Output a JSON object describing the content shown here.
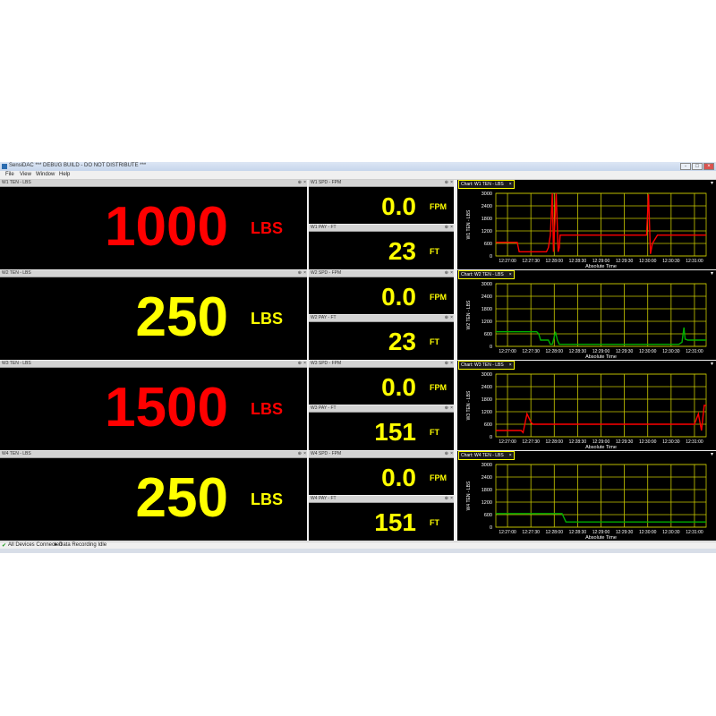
{
  "window": {
    "title": "SensiDAC *** DEBUG BUILD - DO NOT DISTRIBUTE ***",
    "buttons": [
      "-",
      "□",
      "×"
    ]
  },
  "menu": [
    "File",
    "View",
    "Window",
    "Help"
  ],
  "rows": [
    {
      "ten": {
        "label": "W1 TEN - LBS",
        "value": "1000",
        "unit": "LBS",
        "color": "#ff0000"
      },
      "spd": {
        "label": "W1 SPD - FPM",
        "value": "0.0",
        "unit": "FPM"
      },
      "pay": {
        "label": "W1 PAY - FT",
        "value": "23",
        "unit": "FT"
      },
      "chart_title": "Chart: W1 TEN - LBS"
    },
    {
      "ten": {
        "label": "W2 TEN - LBS",
        "value": "250",
        "unit": "LBS",
        "color": "#ffff00"
      },
      "spd": {
        "label": "W2 SPD - FPM",
        "value": "0.0",
        "unit": "FPM"
      },
      "pay": {
        "label": "W2 PAY - FT",
        "value": "23",
        "unit": "FT"
      },
      "chart_title": "Chart: W2 TEN - LBS"
    },
    {
      "ten": {
        "label": "W3 TEN - LBS",
        "value": "1500",
        "unit": "LBS",
        "color": "#ff0000"
      },
      "spd": {
        "label": "W3 SPD - FPM",
        "value": "0.0",
        "unit": "FPM"
      },
      "pay": {
        "label": "W3 PAY - FT",
        "value": "151",
        "unit": "FT"
      },
      "chart_title": "Chart: W3 TEN - LBS"
    },
    {
      "ten": {
        "label": "W4 TEN - LBS",
        "value": "250",
        "unit": "LBS",
        "color": "#ffff00"
      },
      "spd": {
        "label": "W4 SPD - FPM",
        "value": "0.0",
        "unit": "FPM"
      },
      "pay": {
        "label": "W4 PAY - FT",
        "value": "151",
        "unit": "FT"
      },
      "chart_title": "Chart: W4 TEN - LBS"
    }
  ],
  "status": {
    "devices": "All Devices Connected",
    "recording": "Data Recording Idle"
  },
  "chart_data": [
    {
      "type": "line",
      "xlabel": "Absolute Time",
      "ylabel": "W1 TEN - LBS",
      "ylim": [
        0,
        3000
      ],
      "yticks": [
        0,
        600,
        1200,
        1800,
        2400,
        3000
      ],
      "xticks": [
        "12:27:00",
        "12:27:30",
        "12:28:00",
        "12:28:30",
        "12:29:00",
        "12:29:30",
        "12:30:00",
        "12:30:30",
        "12:31:00"
      ],
      "xlim": [
        0,
        540
      ],
      "grid": true,
      "series": [
        {
          "color": "#ff0000",
          "x": [
            0,
            55,
            60,
            130,
            135,
            140,
            145,
            148,
            155,
            160,
            163,
            165,
            180,
            185,
            380,
            387,
            392,
            397,
            402,
            415,
            540
          ],
          "y": [
            650,
            650,
            200,
            200,
            400,
            1000,
            3000,
            200,
            3000,
            200,
            400,
            1000,
            1000,
            1000,
            1000,
            1000,
            2950,
            100,
            600,
            1000,
            1000
          ]
        }
      ]
    },
    {
      "type": "line",
      "xlabel": "Absolute Time",
      "ylabel": "W2 TEN - LBS",
      "ylim": [
        0,
        3000
      ],
      "yticks": [
        0,
        600,
        1200,
        1800,
        2400,
        3000
      ],
      "xticks": [
        "12:27:00",
        "12:27:30",
        "12:28:00",
        "12:28:30",
        "12:29:00",
        "12:29:30",
        "12:30:00",
        "12:30:30",
        "12:31:00"
      ],
      "xlim": [
        0,
        540
      ],
      "grid": true,
      "series": [
        {
          "color": "#00b000",
          "x": [
            0,
            105,
            110,
            115,
            135,
            140,
            145,
            148,
            153,
            158,
            163,
            470,
            478,
            483,
            486,
            493,
            540
          ],
          "y": [
            700,
            700,
            600,
            300,
            300,
            100,
            100,
            300,
            700,
            300,
            100,
            100,
            200,
            900,
            350,
            300,
            300
          ]
        }
      ]
    },
    {
      "type": "line",
      "xlabel": "Absolute Time",
      "ylabel": "W3 TEN - LBS",
      "ylim": [
        0,
        3000
      ],
      "yticks": [
        0,
        600,
        1200,
        1800,
        2400,
        3000
      ],
      "xticks": [
        "12:27:00",
        "12:27:30",
        "12:28:00",
        "12:28:30",
        "12:29:00",
        "12:29:30",
        "12:30:00",
        "12:30:30",
        "12:31:00"
      ],
      "xlim": [
        0,
        540
      ],
      "grid": true,
      "series": [
        {
          "color": "#ff0000",
          "x": [
            0,
            65,
            70,
            80,
            90,
            95,
            500,
            510,
            520,
            528,
            535,
            540
          ],
          "y": [
            300,
            300,
            200,
            1100,
            700,
            600,
            600,
            600,
            1100,
            300,
            1500,
            1500
          ]
        }
      ]
    },
    {
      "type": "line",
      "xlabel": "Absolute Time",
      "ylabel": "W4 TEN - LBS",
      "ylim": [
        0,
        3000
      ],
      "yticks": [
        0,
        600,
        1200,
        1800,
        2400,
        3000
      ],
      "xticks": [
        "12:27:00",
        "12:27:30",
        "12:28:00",
        "12:28:30",
        "12:29:00",
        "12:29:30",
        "12:30:00",
        "12:30:30",
        "12:31:00"
      ],
      "xlim": [
        0,
        540
      ],
      "grid": true,
      "series": [
        {
          "color": "#00b000",
          "x": [
            0,
            170,
            180,
            540
          ],
          "y": [
            650,
            650,
            250,
            250
          ]
        }
      ]
    }
  ],
  "colors": {
    "accent_yellow": "#ffff00",
    "alarm_red": "#ff0000",
    "trend_green": "#00b000"
  },
  "icons": {
    "status_ok": "green-check-icon",
    "status_rec": "record-icon"
  }
}
